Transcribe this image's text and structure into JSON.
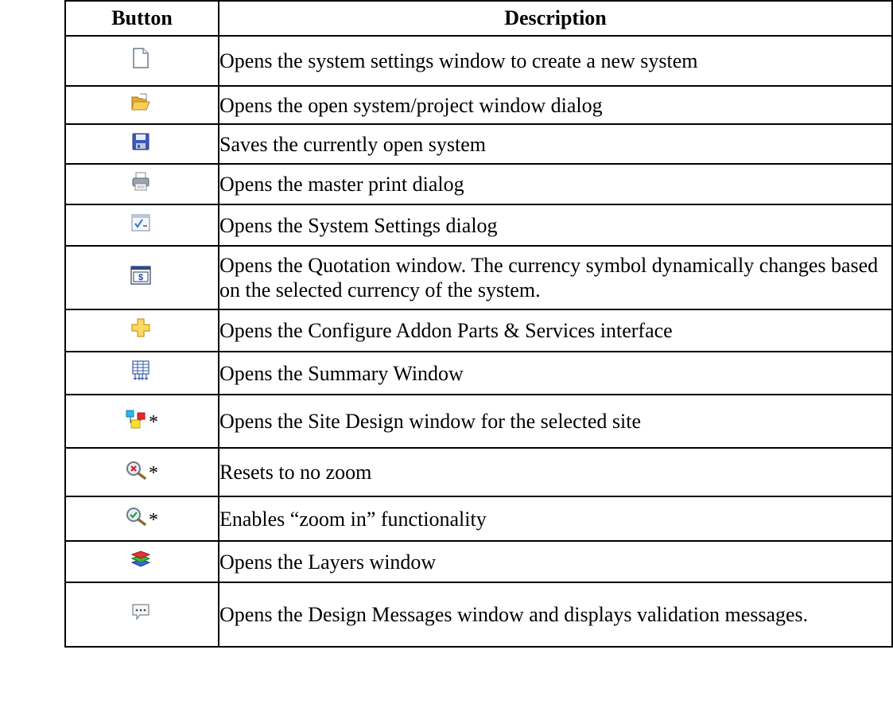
{
  "header": {
    "button": "Button",
    "description": "Description"
  },
  "rows": [
    {
      "icon": "new-document-icon",
      "asterisk": "",
      "description": "Opens the system settings window to create a new system"
    },
    {
      "icon": "open-folder-icon",
      "asterisk": "",
      "description": "Opens the open system/project window dialog"
    },
    {
      "icon": "save-disk-icon",
      "asterisk": "",
      "description": "Saves the currently open system"
    },
    {
      "icon": "printer-icon",
      "asterisk": "",
      "description": "Opens the master print dialog"
    },
    {
      "icon": "settings-checklist-icon",
      "asterisk": "",
      "description": "Opens the System Settings dialog"
    },
    {
      "icon": "quotation-dollar-icon",
      "asterisk": "",
      "description": "Opens the Quotation window. The currency symbol dynamically changes based on the selected currency of the system."
    },
    {
      "icon": "addon-plus-icon",
      "asterisk": "",
      "description": "Opens the Configure Addon Parts & Services interface"
    },
    {
      "icon": "summary-grid-icon",
      "asterisk": "",
      "description": "Opens the Summary Window"
    },
    {
      "icon": "site-design-icon",
      "asterisk": "*",
      "description": "Opens the Site Design window for the selected site"
    },
    {
      "icon": "zoom-reset-icon",
      "asterisk": "*",
      "description": "Resets to no zoom"
    },
    {
      "icon": "zoom-in-icon",
      "asterisk": "*",
      "description": "Enables “zoom in” functionality"
    },
    {
      "icon": "layers-icon",
      "asterisk": "",
      "description": "Opens the Layers window"
    },
    {
      "icon": "design-messages-icon",
      "asterisk": "",
      "description": "Opens the Design Messages window and displays validation messages."
    }
  ],
  "colors": {
    "border": "#000000",
    "text": "#000000"
  }
}
